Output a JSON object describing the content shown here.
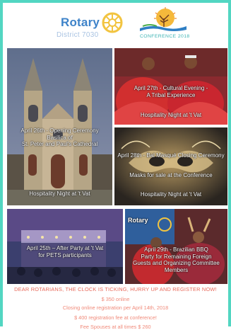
{
  "header": {
    "brand": "Rotary",
    "district": "District 7030",
    "conference_label": "CONFERENCE 2018",
    "wheel_icon": "rotary-wheel-icon",
    "conference_logo_icon": "sun-tree-logo-icon"
  },
  "tiles": {
    "april26": {
      "line1": "April 26th - Opening Ceremony",
      "line2": "Basilica of",
      "line3": "St. Peter and Paul's Cathedral",
      "footer": "Hospitality Night at 't Vat"
    },
    "april27": {
      "line1": "April 27th - Cultural Evening -",
      "line2": "A Tribal Experience",
      "footer": "Hospitality Night at 't Vat"
    },
    "april28": {
      "line1": "April 28th - Bal Masqué Closing Ceremony",
      "line2": "Masks for sale at the Conference",
      "footer": "Hospitality Night at 't Vat"
    },
    "april25": {
      "line1": "April 25th – After Party at 't Vat",
      "line2": "for PETS participants"
    },
    "april29": {
      "line1": "April 29th - Brazilian BBQ",
      "line2": "Party for Remaining Foreign",
      "line3": "Guests and Organizing Committee",
      "line4": "Members",
      "banner": "Rotary"
    }
  },
  "footer": {
    "cta": "DEAR ROTARIANS, THE CLOCK IS TICKING, HURRY UP AND REGISTER NOW!",
    "price_online": "$ 350 online",
    "closing": "Closing online registration per April 14th, 2018",
    "price_conference": "$ 400 registration fee at conference!",
    "fee": "Fee Spouses at all times $ 260"
  },
  "colors": {
    "accent_border": "#52d6c2",
    "rotary_blue": "#3e83c9",
    "cta_red": "#e8695a"
  }
}
